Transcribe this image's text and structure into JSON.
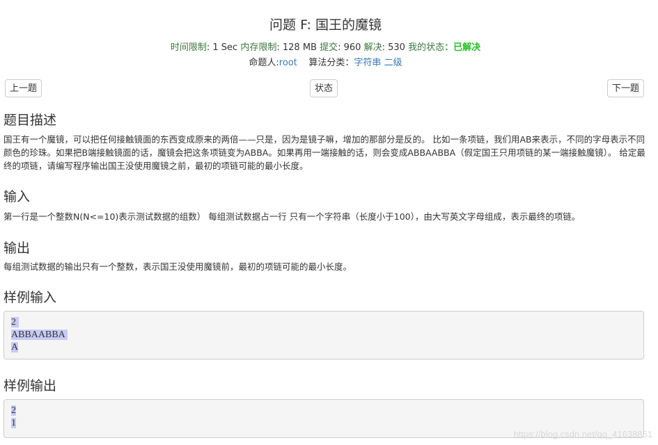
{
  "problem": {
    "title": "问题 F: 国王的魔镜"
  },
  "meta": {
    "time_label": "时间限制",
    "time_value": ": 1 Sec",
    "mem_label": "内存限制",
    "mem_value": ": 128 MB",
    "submit_label": "提交",
    "submit_value": ": 960",
    "solved_label": "解决",
    "solved_value": ": 530",
    "state_label": "我的状态",
    "state_value": "：已解决",
    "author_label": "命题人:",
    "author_value": "root",
    "category_label": "算法分类：",
    "category_tag1": "字符串",
    "category_tag2": "二级"
  },
  "nav": {
    "prev": "上一题",
    "status": "状态",
    "next": "下一题"
  },
  "sections": {
    "desc_title": "题目描述",
    "desc_text": "国王有一个魔镜，可以把任何接触镜面的东西变成原来的两倍——只是，因为是镜子嘛，增加的那部分是反的。 比如一条项链，我们用AB来表示，不同的字母表示不同颜色的珍珠。如果把B端接触镜面的话，魔镜会把这条项链变为ABBA。如果再用一端接触的话，则会变成ABBAABBA（假定国王只用项链的某一端接触魔镜）。 给定最终的项链，请编写程序输出国王没使用魔镜之前，最初的项链可能的最小长度。",
    "input_title": "输入",
    "input_text": "第一行是一个整数N(N<=10)表示测试数据的组数） 每组测试数据占一行 只有一个字符串（长度小于100），由大写英文字母组成，表示最终的项链。",
    "output_title": "输出",
    "output_text": "每组测试数据的输出只有一个整数，表示国王没使用魔镜前，最初的项链可能的最小长度。",
    "sample_input_title": "样例输入",
    "sample_input": [
      "2 ",
      "ABBAABBA ",
      "A"
    ],
    "sample_output_title": "样例输出",
    "sample_output": [
      "2",
      "1"
    ]
  },
  "watermark": "https://blog.csdn.net/qq_41638851"
}
